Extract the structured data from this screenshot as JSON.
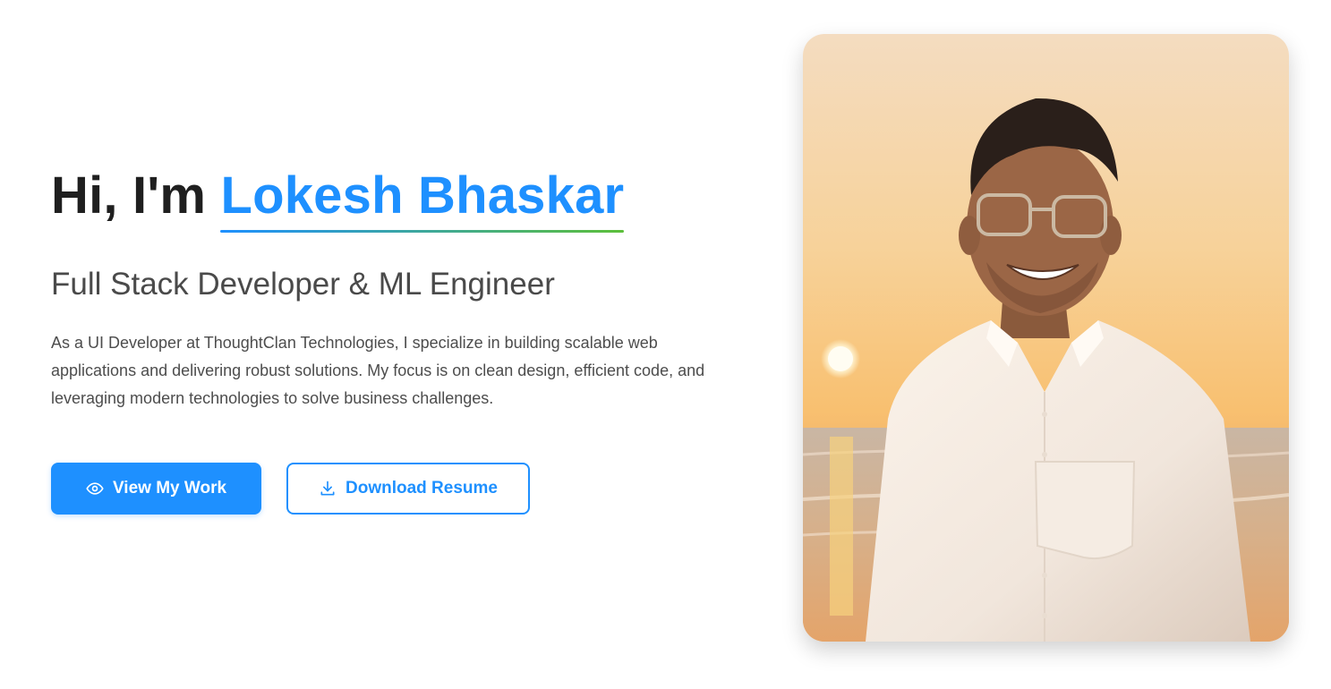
{
  "hero": {
    "greeting": "Hi, I'm",
    "name": "Lokesh Bhaskar",
    "subtitle": "Full Stack Developer & ML Engineer",
    "bio": "As a UI Developer at ThoughtClan Technologies, I specialize in building scalable web applications and delivering robust solutions. My focus is on clean design, efficient code, and leveraging modern technologies to solve business challenges.",
    "primary_button": {
      "label": "View My Work",
      "icon": "eye-icon"
    },
    "secondary_button": {
      "label": "Download Resume",
      "icon": "download-icon"
    }
  },
  "colors": {
    "accent": "#1e90ff",
    "underline_start": "#1e90ff",
    "underline_end": "#5cbf3a",
    "heading": "#1f1f1f",
    "text": "#4d4d4d"
  }
}
